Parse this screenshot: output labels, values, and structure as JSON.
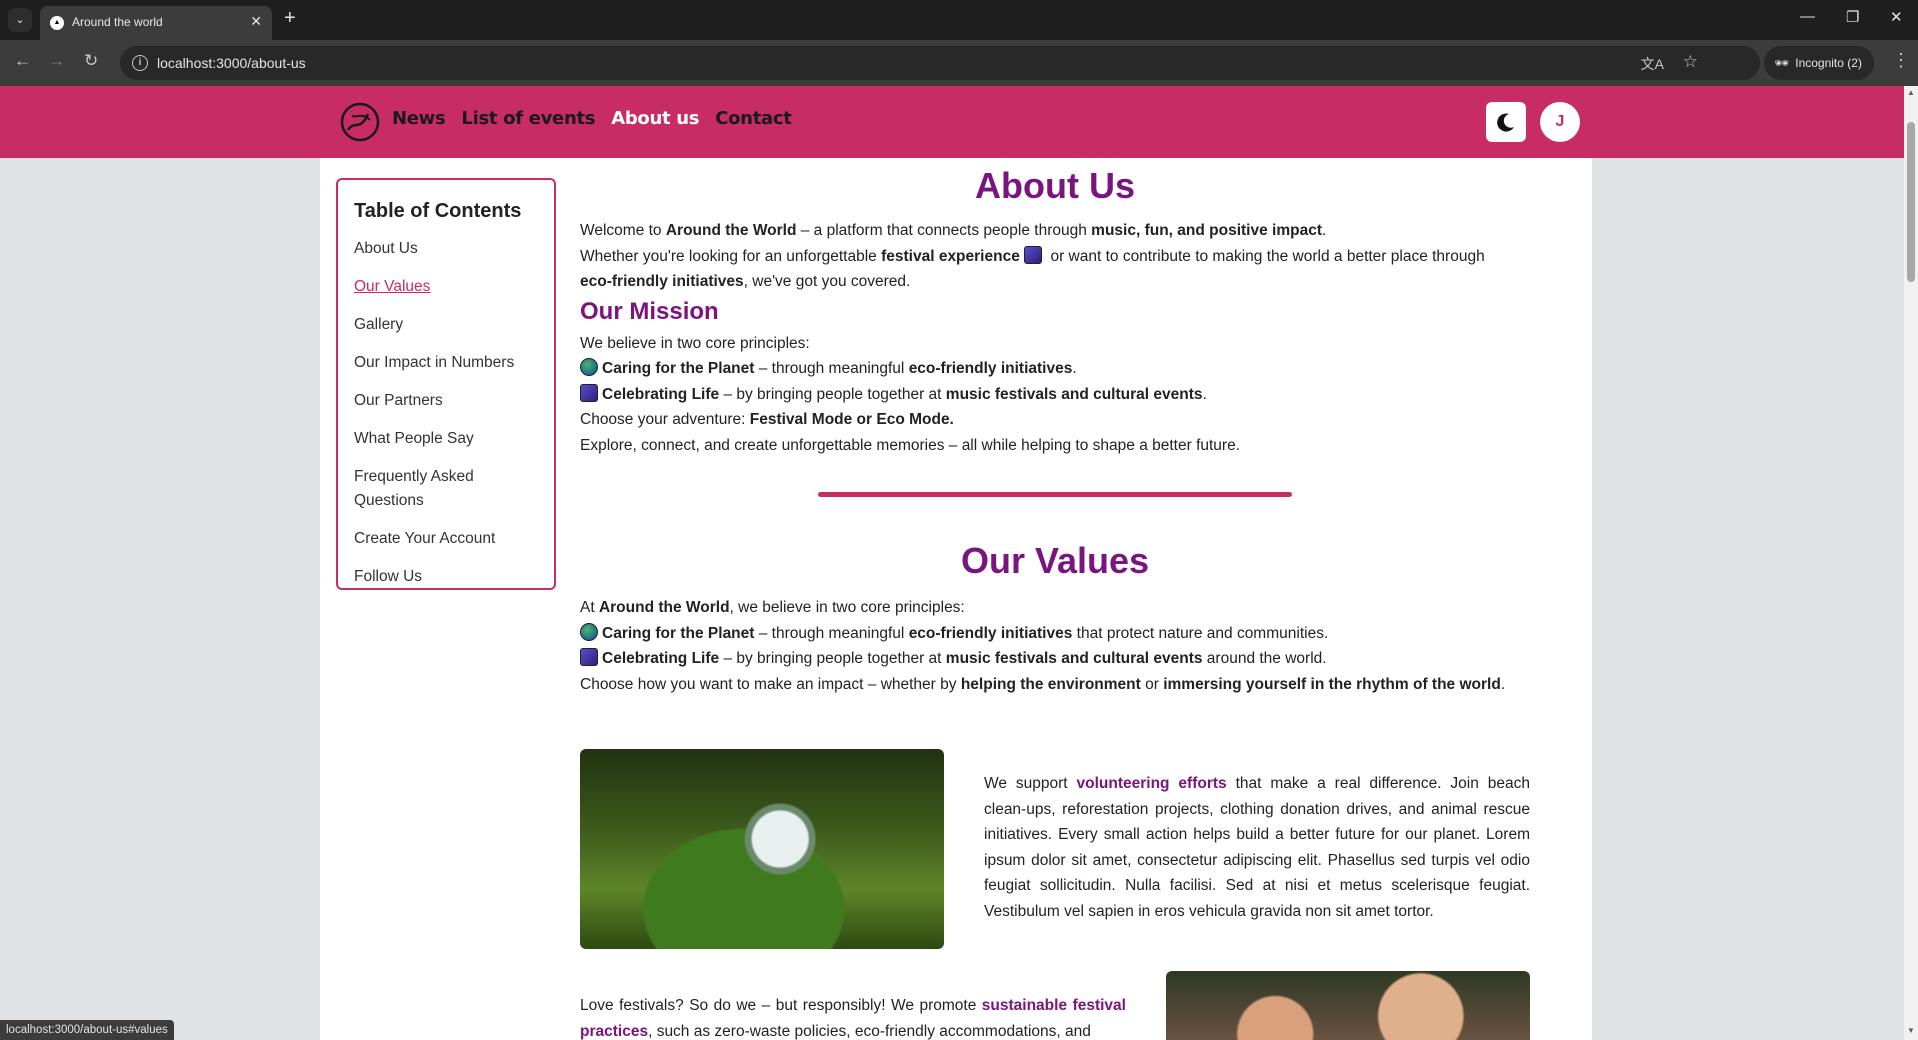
{
  "browser": {
    "tab_title": "Around the world",
    "url": "localhost:3000/about-us",
    "incognito_label": "Incognito (2)",
    "status_url": "localhost:3000/about-us#values"
  },
  "header": {
    "nav": [
      "News",
      "List of events",
      "About us",
      "Contact"
    ],
    "active_nav": "About us",
    "user_initial": "J",
    "brand_color": "#c72c64"
  },
  "toc": {
    "title": "Table of Contents",
    "items": [
      "About Us",
      "Our Values",
      "Gallery",
      "Our Impact in Numbers",
      "Our Partners",
      "What People Say",
      "Frequently Asked Questions",
      "Create Your Account",
      "Follow Us"
    ],
    "active": "Our Values"
  },
  "about": {
    "title": "About Us",
    "p1_a": "Welcome to ",
    "p1_b": "Around the World",
    "p1_c": " – a platform that connects people through ",
    "p1_d": "music, fun, and positive impact",
    "p1_e": ".",
    "p2_a": "Whether you're looking for an unforgettable ",
    "p2_b": "festival experience",
    "p2_c": " or want to contribute to making the world a better place through",
    "p3_a": "eco-friendly initiatives",
    "p3_b": ", we've got you covered."
  },
  "mission": {
    "title": "Our Mission",
    "intro": "We believe in two core principles:",
    "l1_a": "Caring for the Planet",
    "l1_b": " – through meaningful ",
    "l1_c": "eco-friendly initiatives",
    "l1_d": ".",
    "l2_a": "Celebrating Life",
    "l2_b": " – by bringing people together at ",
    "l2_c": "music festivals and cultural events",
    "l2_d": ".",
    "choose_a": "Choose your adventure: ",
    "choose_b": "Festival Mode or Eco Mode.",
    "explore": "Explore, connect, and create unforgettable memories – all while helping to shape a better future."
  },
  "values": {
    "title": "Our Values",
    "intro_a": "At ",
    "intro_b": "Around the World",
    "intro_c": ", we believe in two core principles:",
    "l1_a": "Caring for the Planet",
    "l1_b": " – through meaningful ",
    "l1_c": "eco-friendly initiatives",
    "l1_d": " that protect nature and communities.",
    "l2_a": "Celebrating Life",
    "l2_b": " – by bringing people together at ",
    "l2_c": "music festivals and cultural events",
    "l2_d": " around the world.",
    "choose_a": "Choose how you want to make an impact – whether by ",
    "choose_b": "helping the environment",
    "choose_c": " or ",
    "choose_d": "immersing yourself in the rhythm of the world",
    "choose_e": ".",
    "volunteer_a": "We support ",
    "volunteer_b": "volunteering efforts",
    "volunteer_c": " that make a real difference. Join beach clean-ups, reforestation projects, clothing donation drives, and animal rescue initiatives. Every small action helps build a better future for our planet. Lorem ipsum dolor sit amet, consectetur adipiscing elit. Phasellus sed turpis vel odio feugiat sollicitudin. Nulla facilisi. Sed at nisi et metus scelerisque feugiat. Vestibulum vel sapien in eros vehicula gravida non sit amet tortor.",
    "fest_a": "Love festivals? So do we – but responsibly! We promote ",
    "fest_b": "sustainable festival practices",
    "fest_c": ", such as zero-waste policies, eco-friendly accommodations, and"
  }
}
